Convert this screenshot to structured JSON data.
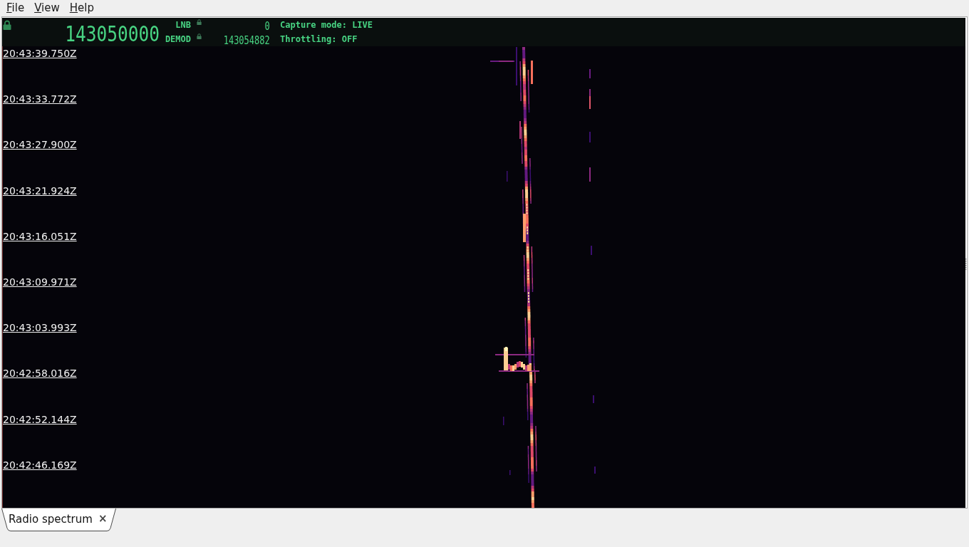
{
  "menu": [
    {
      "label": "File"
    },
    {
      "label": "View"
    },
    {
      "label": "Help"
    }
  ],
  "header": {
    "frequency": "143050000",
    "rows": [
      {
        "label": "LNB",
        "value": "0",
        "status": "Capture mode: LIVE"
      },
      {
        "label": "DEMOD",
        "value": "143054882",
        "status": "Throttling: OFF"
      }
    ]
  },
  "waterfall": {
    "timestamps": [
      "20:43:39.750Z",
      "20:43:33.772Z",
      "20:43:27.900Z",
      "20:43:21.924Z",
      "20:43:16.051Z",
      "20:43:09.971Z",
      "20:43:03.993Z",
      "20:42:58.016Z",
      "20:42:52.144Z",
      "20:42:46.169Z"
    ]
  },
  "tabs": [
    {
      "label": "Radio spectrum",
      "selected": true,
      "close": "×"
    }
  ]
}
